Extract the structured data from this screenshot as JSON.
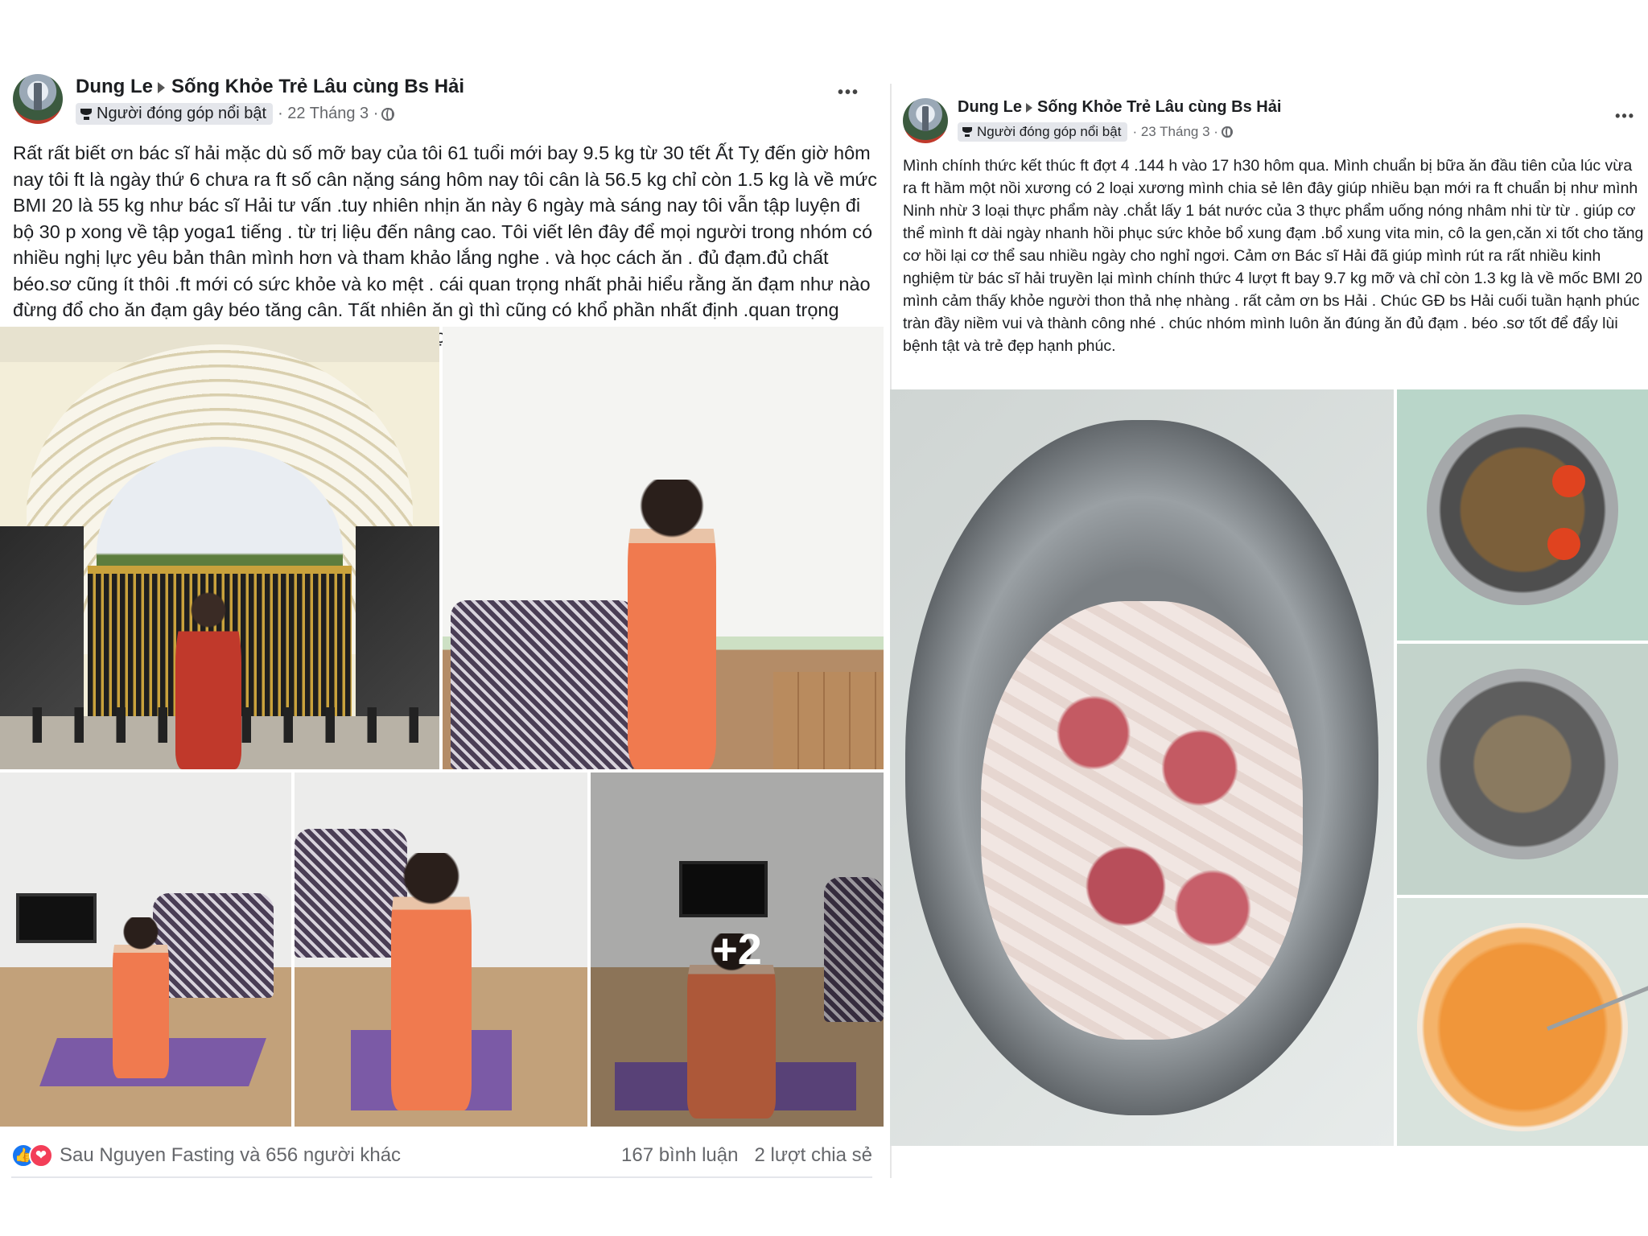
{
  "left_post": {
    "author": "Dung Le",
    "group": "Sống Khỏe Trẻ Lâu cùng Bs Hải",
    "badge": "Người đóng góp nổi bật",
    "date": "· 22 Tháng 3 ·",
    "more": "•••",
    "body": "Rất rất biết ơn bác sĩ hải mặc dù số mỡ bay của tôi 61 tuổi mới bay 9.5 kg từ 30 tết Ất Tỵ đến giờ hôm nay tôi ft là ngày thứ 6 chưa ra ft số cân nặng sáng hôm nay tôi   cân là 56.5 kg chỉ còn 1.5 kg là về mức BMI 20 là 55 kg như bác sĩ Hải tư vấn .tuy nhiên nhịn ăn này 6 ngày mà sáng nay tôi vẫn tập luyện  đi bộ 30 p xong về tập yoga1 tiếng . từ trị liệu đến nâng cao.  Tôi viết lên đây để mọi người trong nhóm  có nhiều nghị lực yêu bản thân mình hơn và tham khảo lắng nghe . và học cách ăn . đủ đạm.đủ chất béo.sơ cũng ít thôi .ft mới có sức khỏe và ko mệt . cái quan trọng nhất phải hiểu rằng  ăn đạm như nào đừng đổ cho ăn đạm gây béo  tăng cân. Tất nhiên ăn gì thì cũng  có khổ phần nhất định .quan trọng mình biết ăn đủ và đúng . Cảm ơn bác sĩ Hải và  mọi người chúc mọi người một ngày mới nhiều niềm vui và tràn đầy năng lượng.",
    "more_photos": "+2",
    "reactions": {
      "like_icon": "👍",
      "love_icon": "❤",
      "names": "Sau Nguyen Fasting và 656 người khác",
      "comments": "167 bình luận",
      "shares": "2 lượt chia sẻ"
    }
  },
  "right_post": {
    "author": "Dung Le",
    "group": "Sống Khỏe Trẻ Lâu cùng Bs Hải",
    "badge": "Người đóng góp nổi bật",
    "date": "· 23 Tháng 3 ·",
    "more": "•••",
    "body": "Mình chính thức kết thúc ft đợt 4 .144 h vào 17 h30  hôm qua. Mình chuẩn bị  bữa ăn đầu tiên của lúc vừa ra ft hầm một nồi xương có 2 loại xương mình chia sẻ lên đây giúp nhiều bạn mới ra ft chuẩn bị như mình  Ninh nhừ 3 loại thực phẩm này .chắt lấy 1 bát nước của 3 thực phẩm uống nóng nhâm nhi từ từ . giúp cơ thể  mình ft dài ngày nhanh hồi phục sức khỏe bổ xung đạm .bổ xung vita min, cô la gen,căn xi tốt cho tăng cơ hồi lại cơ thể sau nhiều ngày cho nghỉ ngơi.  Cảm ơn Bác sĩ Hải  đã giúp mình rút ra rất nhiều kinh nghiệm từ bác sĩ hải truyền lại mình chính thức 4 lượt ft bay 9.7 kg mỡ và chỉ còn 1.3 kg là về mốc BMI 20 mình cảm thấy khỏe  người thon thả nhẹ nhàng . rất cảm ơn bs Hải . Chúc GĐ bs Hải cuối tuần hạnh phúc tràn đầy niềm vui và thành công nhé . chúc nhóm mình luôn ăn đúng ăn đủ đạm . béo .sơ tốt để đẩy lùi bệnh tật và trẻ đẹp hạnh phúc."
  }
}
